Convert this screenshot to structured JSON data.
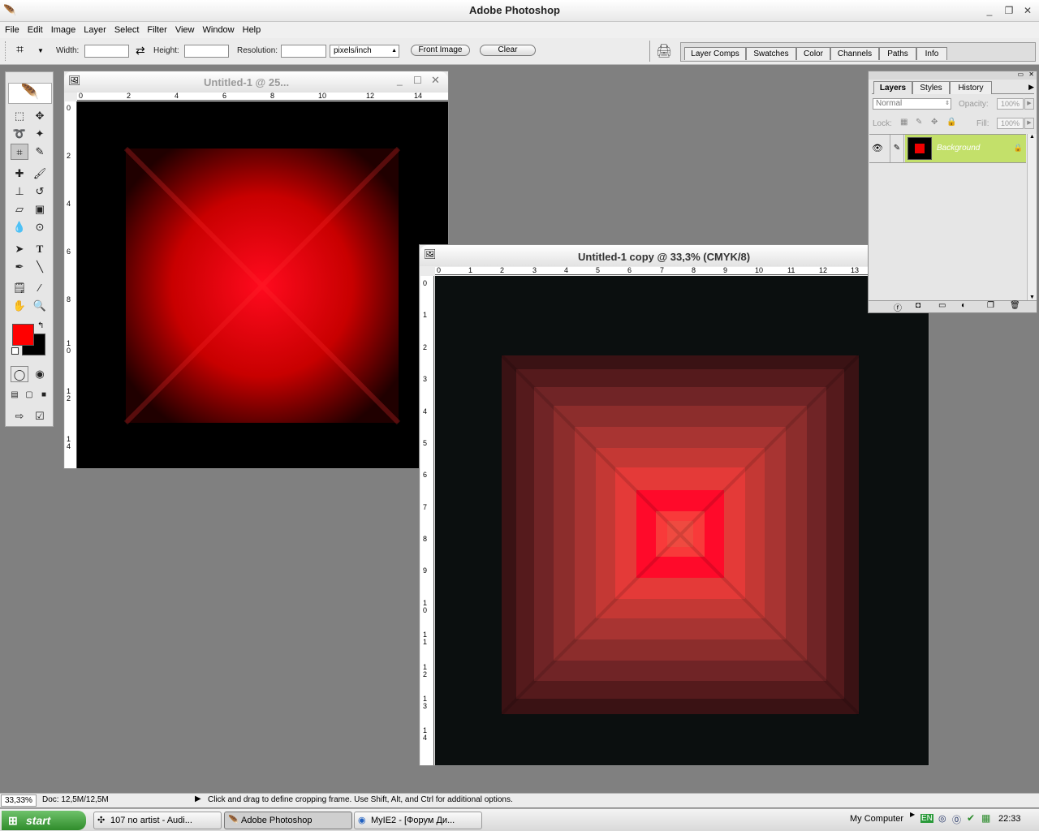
{
  "app": {
    "title": "Adobe Photoshop"
  },
  "window_controls": {
    "minimize": "_",
    "restore": "❐",
    "close": "✕"
  },
  "menu": [
    "File",
    "Edit",
    "Image",
    "Layer",
    "Select",
    "Filter",
    "View",
    "Window",
    "Help"
  ],
  "options": {
    "width_label": "Width:",
    "height_label": "Height:",
    "resolution_label": "Resolution:",
    "units_value": "pixels/inch",
    "front_image_label": "Front Image",
    "clear_label": "Clear"
  },
  "palette_well": [
    "Layer Comps",
    "Swatches",
    "Color",
    "Channels",
    "Paths",
    "Info"
  ],
  "toolbox": {
    "foreground_color": "#ff0000",
    "background_color": "#000000",
    "tools": [
      "rect-marquee",
      "move",
      "lasso",
      "magic-wand",
      "crop",
      "slice",
      "healing-brush",
      "brush",
      "clone-stamp",
      "history-brush",
      "eraser",
      "gradient",
      "blur",
      "dodge",
      "path-selection",
      "type",
      "pen",
      "line",
      "notes",
      "eyedropper",
      "hand",
      "zoom"
    ]
  },
  "documents": [
    {
      "title": "Untitled-1 @ 25...",
      "ruler_x": [
        "0",
        "2",
        "4",
        "6",
        "8",
        "10",
        "12",
        "14"
      ],
      "ruler_y": [
        "0",
        "2",
        "4",
        "6",
        "8",
        "1 0",
        "1 2",
        "1 4"
      ]
    },
    {
      "title": "Untitled-1 copy @ 33,3% (CMYK/8)",
      "ruler_x": [
        "0",
        "1",
        "2",
        "3",
        "4",
        "5",
        "6",
        "7",
        "8",
        "9",
        "10",
        "11",
        "12",
        "13"
      ],
      "ruler_y": [
        "0",
        "1",
        "2",
        "3",
        "4",
        "5",
        "6",
        "7",
        "8",
        "9",
        "1 0",
        "1 1",
        "1 2",
        "1 3",
        "1 4"
      ]
    }
  ],
  "layers_panel": {
    "tabs": [
      "Layers",
      "Styles",
      "History"
    ],
    "blend_mode": "Normal",
    "opacity_label": "Opacity:",
    "opacity_value": "100%",
    "lock_label": "Lock:",
    "fill_label": "Fill:",
    "fill_value": "100%",
    "layer_name": "Background",
    "layer_highlight": "#c3e06a"
  },
  "status": {
    "zoom": "33,33%",
    "doc": "Doc: 12,5M/12,5M",
    "hint": "Click and drag to define cropping frame. Use Shift, Alt, and Ctrl for additional options."
  },
  "taskbar": {
    "start": "start",
    "tasks": [
      "107 no artist - Audi...",
      "Adobe Photoshop",
      "MyIE2 - [Форум Ди..."
    ],
    "my_computer": "My Computer",
    "lang": "EN",
    "time": "22:33"
  }
}
